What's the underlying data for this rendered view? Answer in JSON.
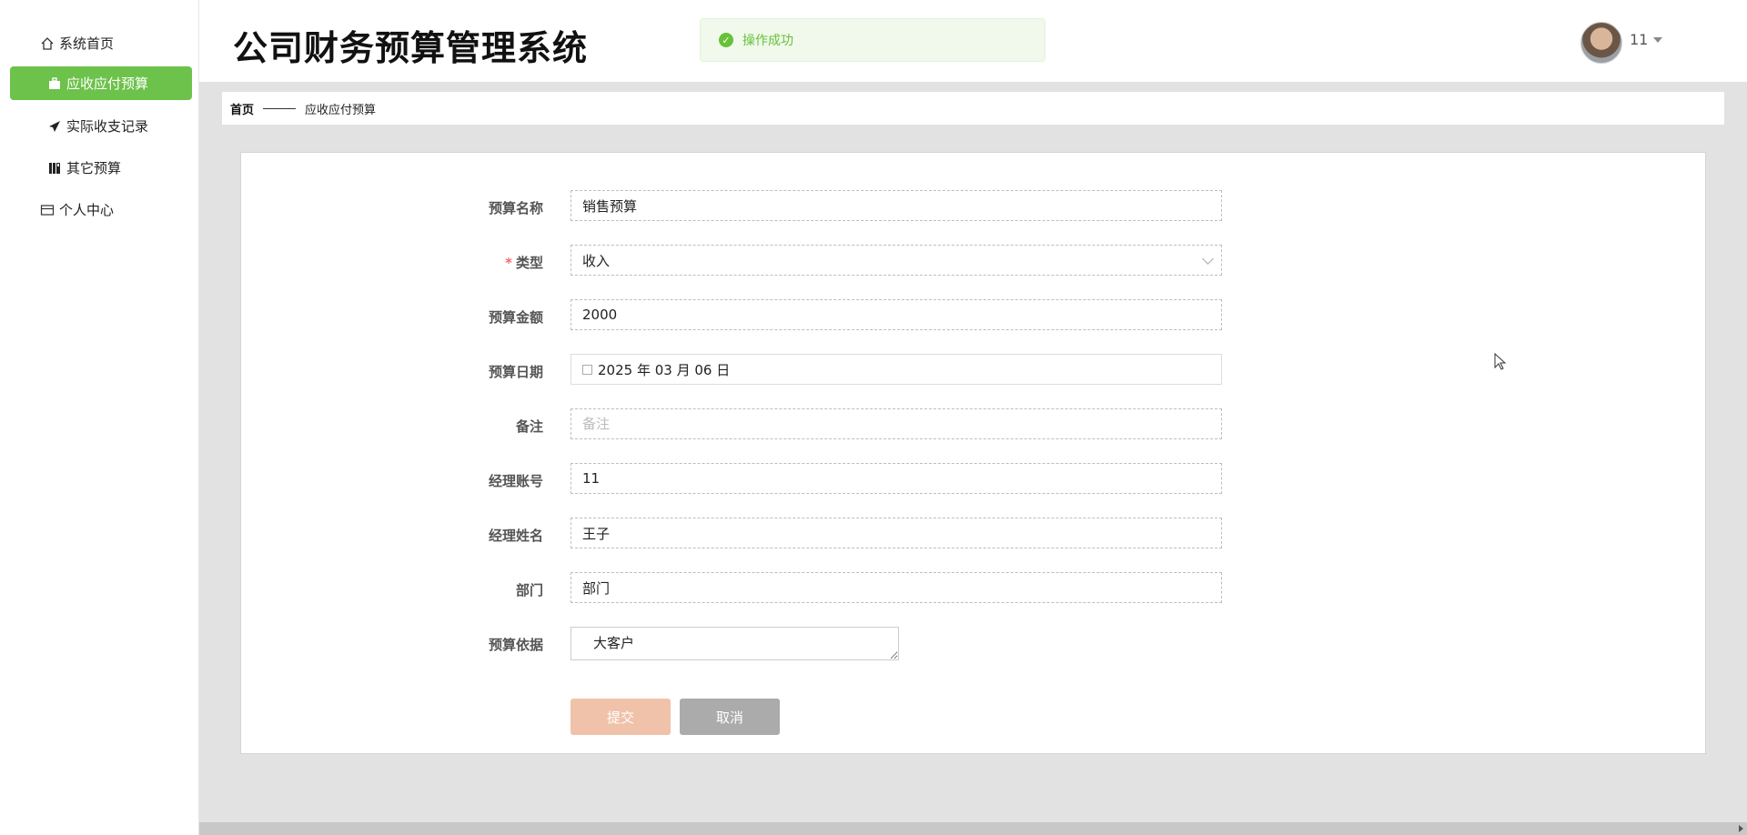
{
  "sidebar": {
    "items": [
      {
        "label": "系统首页",
        "icon": "home-icon"
      },
      {
        "label": "应收应付预算",
        "icon": "briefcase-icon",
        "active": true
      },
      {
        "label": "实际收支记录",
        "icon": "paper-plane-icon"
      },
      {
        "label": "其它预算",
        "icon": "book-icon"
      },
      {
        "label": "个人中心",
        "icon": "card-icon"
      }
    ]
  },
  "header": {
    "title": "公司财务预算管理系统",
    "toast": "操作成功",
    "username": "11"
  },
  "breadcrumb": {
    "home": "首页",
    "current": "应收应付预算"
  },
  "form": {
    "name_label": "预算名称",
    "name_value": "销售预算",
    "type_required": "*",
    "type_label": "类型",
    "type_value": "收入",
    "amount_label": "预算金额",
    "amount_value": "2000",
    "date_label": "预算日期",
    "date_value": "2025 年 03 月 06 日",
    "remark_label": "备注",
    "remark_placeholder": "备注",
    "manager_account_label": "经理账号",
    "manager_account_value": "11",
    "manager_name_label": "经理姓名",
    "manager_name_value": "王子",
    "department_label": "部门",
    "department_value": "部门",
    "basis_label": "预算依据",
    "basis_value": "大客户",
    "submit_label": "提交",
    "cancel_label": "取消"
  },
  "colors": {
    "accent": "#6cc24a",
    "toast_bg": "#f0f9eb",
    "toast_text": "#67c23a",
    "submit_bg": "#f0c2a9",
    "cancel_bg": "#ababab"
  }
}
